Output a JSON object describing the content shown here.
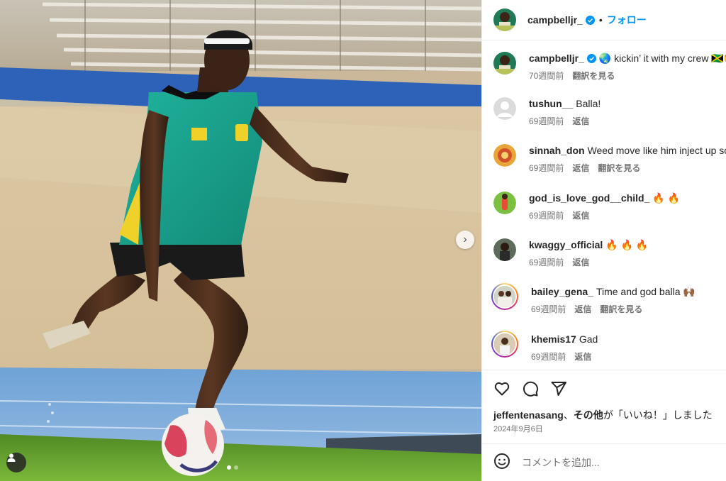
{
  "header": {
    "username": "campbelljr_",
    "separator": "•",
    "follow_label": "フォロー"
  },
  "comments": [
    {
      "username": "campbelljr_",
      "text": "🌏 kickin’ it with my crew 🇯🇲🤩",
      "time": "70週間前",
      "actions": [
        "翻訳を見る"
      ],
      "verified": true,
      "ring": false
    },
    {
      "username": "tushun__",
      "text": "Balla!",
      "time": "69週間前",
      "actions": [
        "返信"
      ],
      "verified": false,
      "ring": false
    },
    {
      "username": "sinnah_don",
      "text": "Weed move like him inject up so",
      "time": "69週間前",
      "actions": [
        "返信",
        "翻訳を見る"
      ],
      "verified": false,
      "ring": false
    },
    {
      "username": "god_is_love_god__child_",
      "text": "🔥 🔥",
      "time": "69週間前",
      "actions": [
        "返信"
      ],
      "verified": false,
      "ring": false
    },
    {
      "username": "kwaggy_official",
      "text": "🔥 🔥 🔥",
      "time": "69週間前",
      "actions": [
        "返信"
      ],
      "verified": false,
      "ring": false
    },
    {
      "username": "bailey_gena_",
      "text": "Time and god balla 🙌🏾",
      "time": "69週間前",
      "actions": [
        "返信",
        "翻訳を見る"
      ],
      "verified": false,
      "ring": true
    },
    {
      "username": "khemis17",
      "text": "Gad",
      "time": "69週間前",
      "actions": [
        "返信"
      ],
      "verified": false,
      "ring": true
    }
  ],
  "likes": {
    "user": "jeffentenasang",
    "middle": "、",
    "others": "その他",
    "suffix": "が「いいね！」しました"
  },
  "post_date": "2024年9月6日",
  "add_comment": {
    "placeholder": "コメントを追加..."
  },
  "icons": {
    "like": "heart-icon",
    "comment": "comment-icon",
    "share": "share-icon",
    "emoji": "emoji-icon",
    "next": "chevron-right-icon",
    "tag": "person-tag-icon",
    "verified": "verified-badge-icon"
  },
  "colors": {
    "accent": "#0095f6",
    "verified": "#0095f6",
    "secondary_text": "#737373",
    "divider": "#efefef"
  },
  "carousel": {
    "slide_count": 2,
    "current_index": 1
  }
}
